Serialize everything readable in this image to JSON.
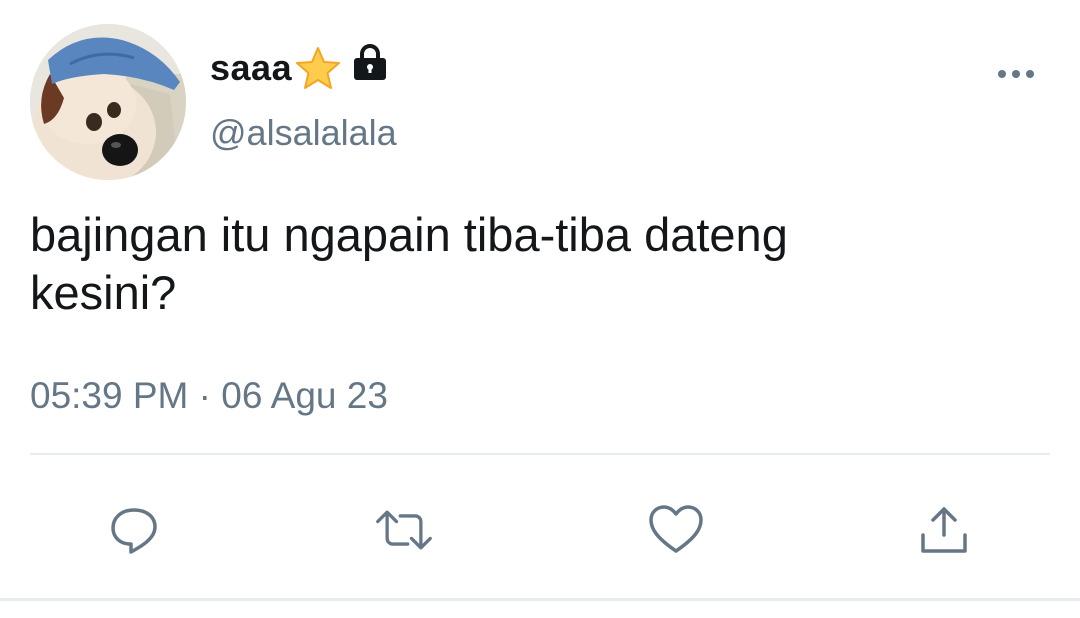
{
  "tweet": {
    "author": {
      "display_name": "saaa",
      "handle": "@alsalalala",
      "badges": [
        "star-emoji-icon",
        "lock-icon"
      ],
      "avatar": "avatar-plush-dog-with-blue-cap"
    },
    "text": "bajingan itu ngapain tiba-tiba dateng\nkesini?",
    "time": "05:39 PM",
    "separator": "·",
    "date": "06 Agu 23",
    "menu_icon": "more-horizontal-icon",
    "actions": [
      {
        "name": "reply",
        "icon": "comment-icon"
      },
      {
        "name": "retweet",
        "icon": "retweet-icon"
      },
      {
        "name": "like",
        "icon": "heart-icon"
      },
      {
        "name": "share",
        "icon": "share-upload-icon"
      }
    ]
  },
  "colors": {
    "text_primary": "#14171a",
    "text_secondary": "#657786",
    "divider": "#e6ecf0",
    "icon": "#657786"
  }
}
